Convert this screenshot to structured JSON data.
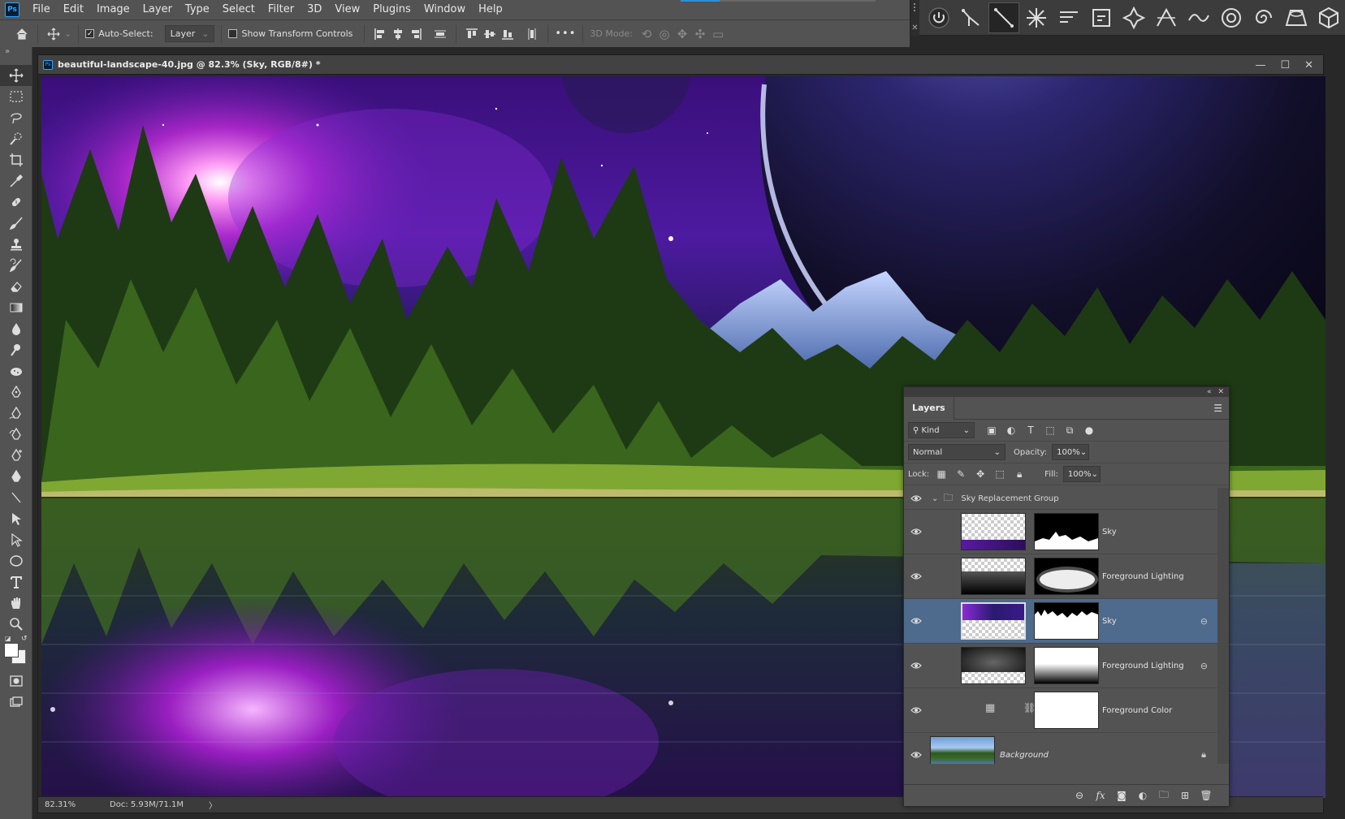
{
  "app": {
    "logo_text": "Ps",
    "accent": "#31a8ff"
  },
  "menubar": {
    "items": [
      "File",
      "Edit",
      "Image",
      "Layer",
      "Type",
      "Select",
      "Filter",
      "3D",
      "View",
      "Plugins",
      "Window",
      "Help"
    ],
    "progress": 0.2
  },
  "options": {
    "auto_select_label": "Auto-Select:",
    "auto_select_checked": true,
    "auto_select_target": "Layer",
    "transform_controls_label": "Show Transform Controls",
    "more_label": "•••",
    "mode_3d_label": "3D Mode:"
  },
  "right_panel": {
    "buttons": [
      "power-icon",
      "branch-path-icon",
      "diagonal-line-icon",
      "starburst-icon",
      "lines-icon",
      "frame-icon",
      "star-path-icon",
      "triangle-perspective-icon",
      "wave-icon",
      "spiral-icon",
      "concentric-icon",
      "trapezoid-icon",
      "cube-icon"
    ],
    "active_index": 2
  },
  "document": {
    "title": "beautiful-landscape-40.jpg @ 82.3% (Sky, RGB/8#) *",
    "zoom_status": "82.31%",
    "doc_status": "Doc: 5.93M/71.1M",
    "status_arrow": "〉"
  },
  "layers_panel": {
    "tab_label": "Layers",
    "filter_kind": "Kind",
    "blend_mode": "Normal",
    "opacity_label": "Opacity:",
    "opacity_value": "100%",
    "lock_label": "Lock:",
    "fill_label": "Fill:",
    "fill_value": "100%",
    "group": {
      "name": "Sky Replacement Group",
      "expanded": true
    },
    "layers": [
      {
        "name": "Sky",
        "thumb": "sky-checker",
        "mask": "mask-peaks",
        "selected": false,
        "linked": false
      },
      {
        "name": "Foreground Lighting",
        "thumb": "fg-checker",
        "mask": "mask-glow",
        "selected": false,
        "linked": false
      },
      {
        "name": "Sky",
        "thumb": "sky-space",
        "mask": "mask-trees",
        "selected": true,
        "linked": true
      },
      {
        "name": "Foreground Lighting",
        "thumb": "fg-dark",
        "mask": "mask-fade",
        "selected": false,
        "linked": true
      },
      {
        "name": "Foreground Color",
        "thumb": "adjustment",
        "mask": "mask-white",
        "selected": false,
        "linked": false
      }
    ],
    "background": {
      "name": "Background",
      "locked": true
    }
  }
}
